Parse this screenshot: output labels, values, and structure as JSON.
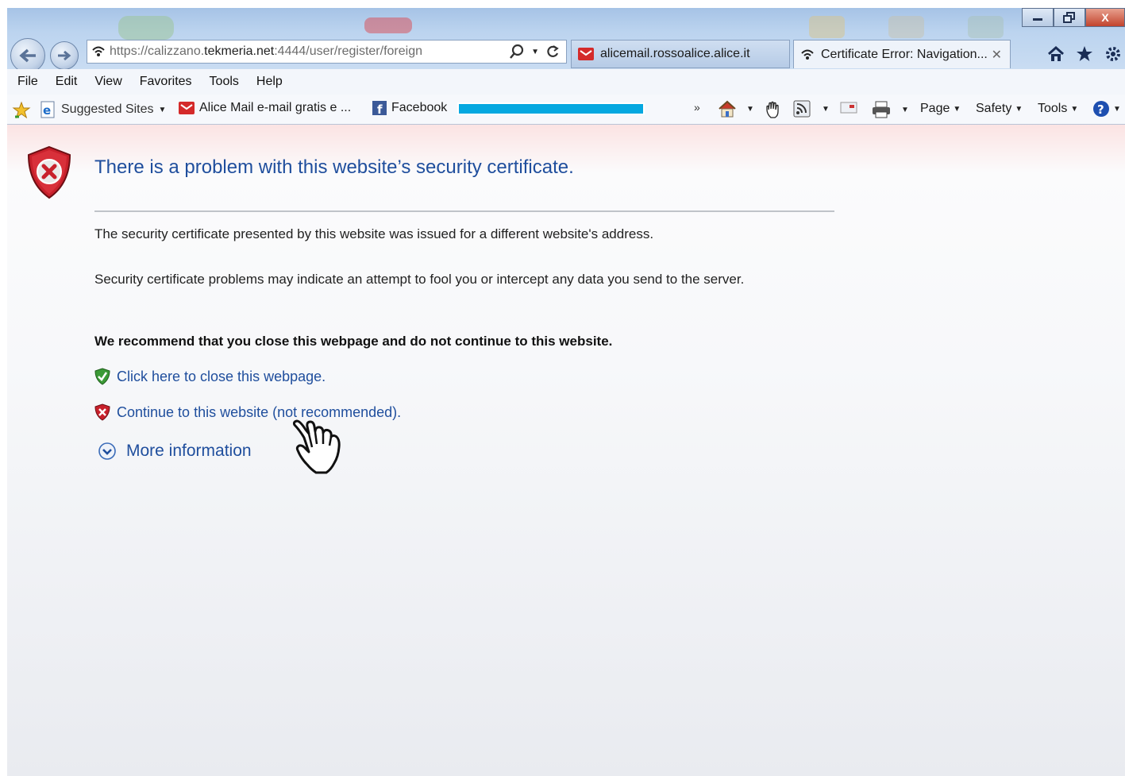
{
  "browser": {
    "address_url_prefix": "https://calizzano.",
    "address_url_domain": "tekmeria.net",
    "address_url_suffix": ":4444/user/register/foreign",
    "tabs": [
      {
        "label": "alicemail.rossoalice.alice.it"
      },
      {
        "label": "Certificate Error: Navigation..."
      }
    ],
    "tab_close_glyph": "✕",
    "window_controls": {
      "close": "X"
    }
  },
  "menu": [
    "File",
    "Edit",
    "View",
    "Favorites",
    "Tools",
    "Help"
  ],
  "favorites": {
    "suggested": "Suggested Sites",
    "alice": "Alice Mail e-mail gratis e ...",
    "facebook": "Facebook",
    "overflow": "»"
  },
  "commands": {
    "page": "Page",
    "safety": "Safety",
    "tools": "Tools"
  },
  "content": {
    "title": "There is a problem with this website’s security certificate.",
    "p1": "The security certificate presented by this website was issued for a different website's address.",
    "p2": "Security certificate problems may indicate an attempt to fool you or intercept any data you send to the server.",
    "p3": "We recommend that you close this webpage and do not continue to this website.",
    "link_close": "Click here to close this webpage.",
    "link_continue": "Continue to this website (not recommended).",
    "more_info": "More information"
  },
  "colors": {
    "link": "#1f4e9d",
    "favbar_progress": "#05a8e0",
    "error_shield": "#c8202b"
  }
}
